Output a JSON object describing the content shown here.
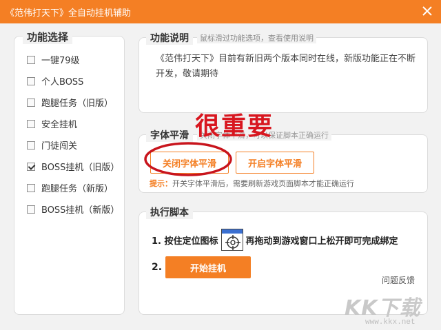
{
  "window": {
    "title": "《范伟打天下》全自动挂机辅助",
    "close_icon": "close-icon"
  },
  "features": {
    "legend": "功能选择",
    "items": [
      {
        "label": "一键79级",
        "checked": false
      },
      {
        "label": "个人BOSS",
        "checked": false
      },
      {
        "label": "跑腿任务（旧版）",
        "checked": false
      },
      {
        "label": "安全挂机",
        "checked": false
      },
      {
        "label": "门徒闯关",
        "checked": false
      },
      {
        "label": "BOSS挂机（旧版）",
        "checked": true
      },
      {
        "label": "跑腿任务（新版）",
        "checked": false
      },
      {
        "label": "BOSS挂机（新版）",
        "checked": false
      }
    ]
  },
  "description": {
    "legend": "功能说明",
    "hint": "鼠标滑过功能选项，查看使用说明",
    "body": "《范伟打天下》目前有新旧两个版本同时在线，新版功能正在不断开发，敬请期待"
  },
  "font_smoothing": {
    "legend": "字体平滑",
    "faint_text": "关闭字体平滑，可以保证脚本正确运行",
    "close_button": "关闭字体平滑",
    "open_button": "开启字体平滑",
    "tip_label": "提示：",
    "tip_text": "开关字体平滑后，需要刷新游戏页面脚本才能正确运行"
  },
  "annotation": {
    "text": "很重要",
    "color": "#d8161f"
  },
  "execute": {
    "legend": "执行脚本",
    "step1_prefix": "1. 按住定位图标",
    "step1_suffix": "再拖动到游戏窗口上松开即可完成绑定",
    "step2_number": "2.",
    "start_button": "开始挂机",
    "feedback_link": "问题反馈"
  },
  "watermark": {
    "brand": "KK下载",
    "url": "www.kkx.net"
  },
  "colors": {
    "accent": "#f47f24",
    "annotation": "#d8161f"
  }
}
